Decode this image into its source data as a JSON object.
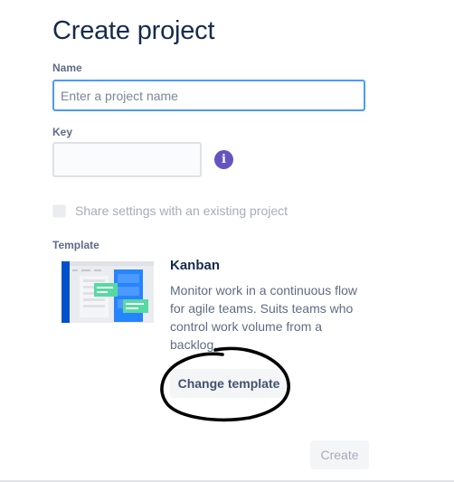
{
  "page": {
    "title": "Create project"
  },
  "form": {
    "name_label": "Name",
    "name_placeholder": "Enter a project name",
    "name_value": "",
    "key_label": "Key",
    "key_value": "",
    "info_icon": "info-icon",
    "share_settings_label": "Share settings with an existing project",
    "share_settings_checked": false,
    "share_settings_disabled": true
  },
  "template": {
    "section_label": "Template",
    "name": "Kanban",
    "description": "Monitor work in a continuous flow for agile teams. Suits teams who control work volume from a backlog.",
    "change_button_label": "Change template"
  },
  "actions": {
    "create_label": "Create",
    "create_disabled": true
  },
  "colors": {
    "title": "#172b4d",
    "label": "#5e6c84",
    "focus_border": "#4c9aff",
    "info_icon": "#6554c0",
    "disabled_text": "#a5adba",
    "annotation_ink": "#000000"
  }
}
